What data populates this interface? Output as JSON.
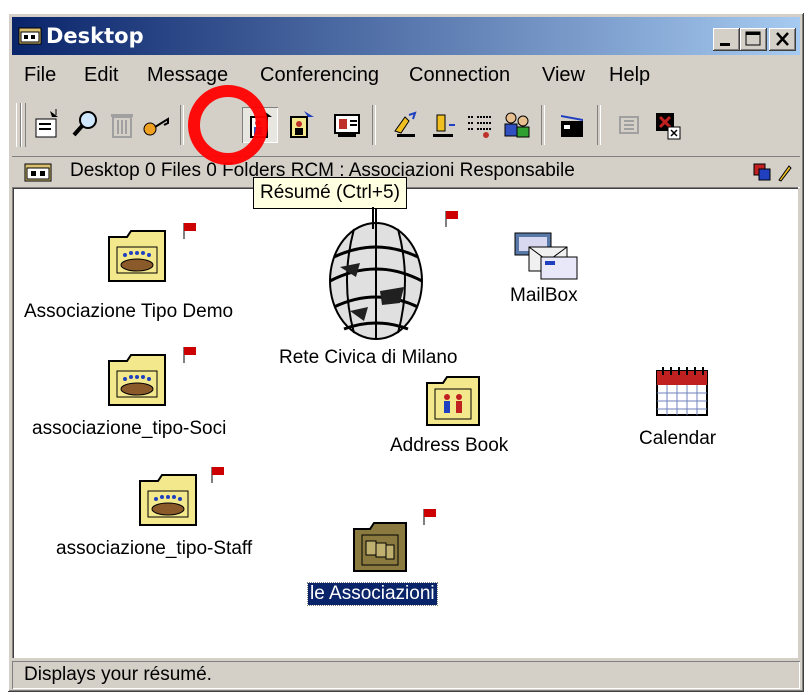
{
  "window": {
    "title": "Desktop"
  },
  "menu": [
    "File",
    "Edit",
    "Message",
    "Conferencing",
    "Connection",
    "View",
    "Help"
  ],
  "address": {
    "path_text": "Desktop   0 Files   0 Folders   RCM : Associazioni Responsabile"
  },
  "tooltip": {
    "text": "Résumé (Ctrl+5)"
  },
  "icons": [
    {
      "label": "Associazione Tipo Demo",
      "type": "conference-folder",
      "flag": true
    },
    {
      "label": "associazione_tipo-Soci",
      "type": "conference-folder",
      "flag": true
    },
    {
      "label": "associazione_tipo-Staff",
      "type": "conference-folder",
      "flag": true
    },
    {
      "label": "Rete Civica di Milano",
      "type": "globe",
      "flag": true
    },
    {
      "label": "MailBox",
      "type": "mailbox",
      "flag": false
    },
    {
      "label": "Address Book",
      "type": "address-book",
      "flag": false
    },
    {
      "label": "Calendar",
      "type": "calendar",
      "flag": false
    },
    {
      "label": "le Associazioni",
      "type": "contacts-folder",
      "flag": true,
      "selected": true
    }
  ],
  "status": {
    "text": "Displays your résumé."
  },
  "colors": {
    "title_start": "#0a246a",
    "title_end": "#a6caf0",
    "flag": "#cc0000",
    "highlight": "#ff0000",
    "folder": "#f3e98c"
  }
}
